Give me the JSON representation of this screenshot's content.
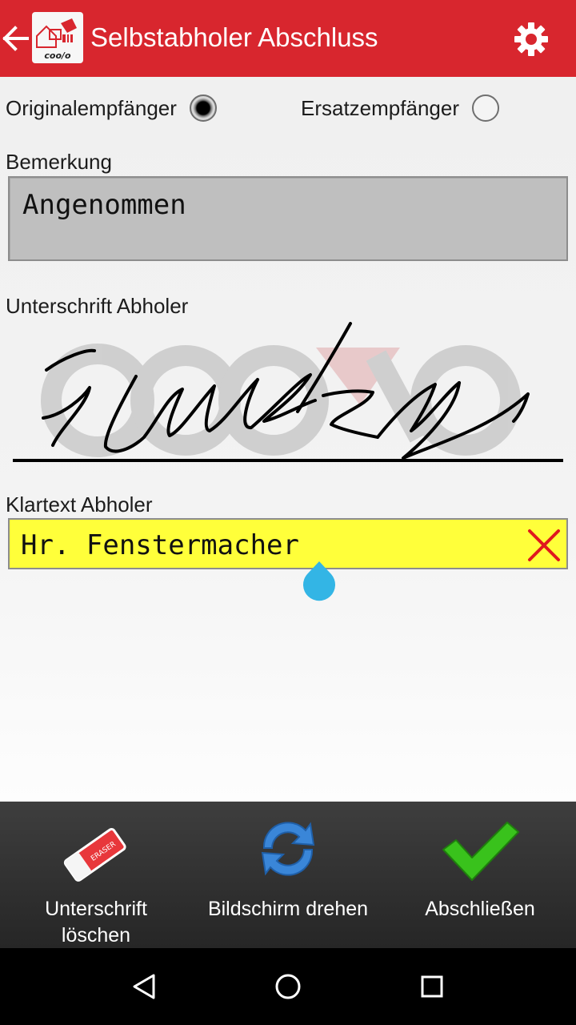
{
  "appbar": {
    "title": "Selbstabholer Abschluss",
    "accent_color": "#d8262e",
    "back_icon": "arrow-left-icon",
    "settings_icon": "gear-icon"
  },
  "recipient": {
    "original_label": "Originalempfänger",
    "original_selected": true,
    "replacement_label": "Ersatzempfänger",
    "replacement_selected": false
  },
  "remark": {
    "label": "Bemerkung",
    "value": "Angenommen"
  },
  "signature": {
    "label": "Unterschrift Abholer"
  },
  "clear_name": {
    "label": "Klartext Abholer",
    "value": "Hr. Fenstermacher",
    "field_color": "#ffff3a",
    "clear_icon": "red-x-icon"
  },
  "actions": [
    {
      "label": "Unterschrift löschen",
      "icon": "eraser-icon"
    },
    {
      "label": "Bildschirm drehen",
      "icon": "rotate-icon"
    },
    {
      "label": "Abschließen",
      "icon": "checkmark-icon"
    }
  ],
  "system_nav": [
    "back-triangle-icon",
    "home-circle-icon",
    "recents-square-icon"
  ]
}
